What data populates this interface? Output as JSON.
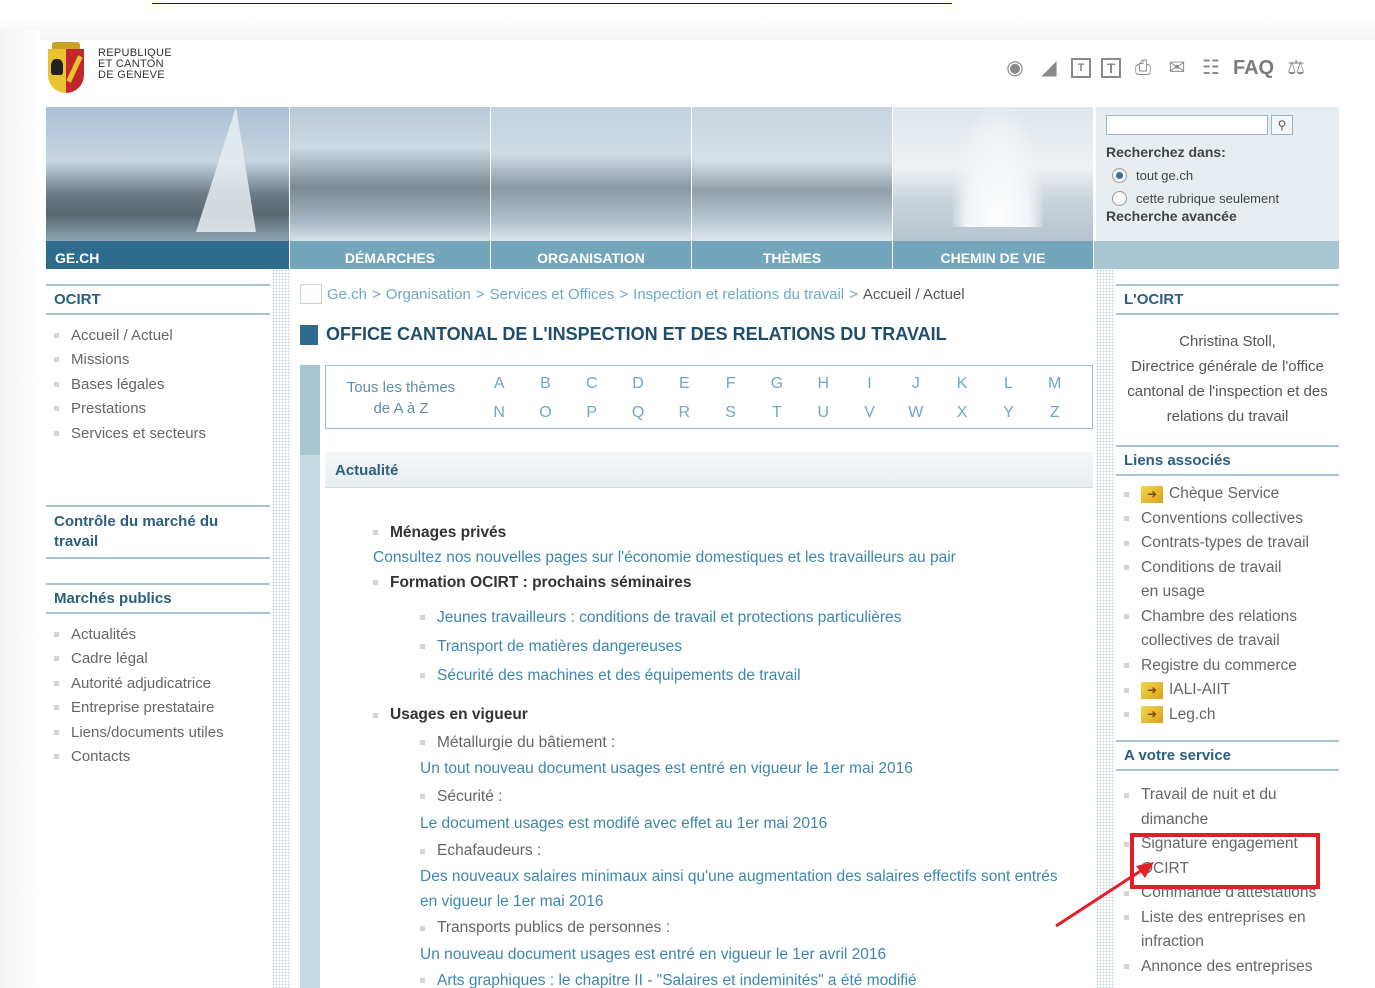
{
  "header": {
    "logo_lines": [
      "REPUBLIQUE",
      "ET CANTON",
      "DE GENEVE"
    ],
    "faq_label": "FAQ"
  },
  "search": {
    "label": "Recherchez dans:",
    "option_all": "tout ge.ch",
    "option_section": "cette rubrique seulement",
    "advanced": "Recherche avancée",
    "selected_option": "tout ge.ch"
  },
  "nav": {
    "home": "GE.CH",
    "items": [
      "DÉMARCHES",
      "ORGANISATION",
      "THÈMES",
      "CHEMIN DE VIE"
    ]
  },
  "left": {
    "ocirt_title": "OCIRT",
    "ocirt_items": [
      "Accueil / Actuel",
      "Missions",
      "Bases légales",
      "Prestations",
      "Services et secteurs"
    ],
    "controle_title": "Contrôle du marché du travail",
    "marches_title": "Marchés publics",
    "marches_items": [
      "Actualités",
      "Cadre légal",
      "Autorité adjudicatrice",
      "Entreprise prestataire",
      "Liens/documents utiles",
      "Contacts"
    ]
  },
  "breadcrumb": {
    "items": [
      "Ge.ch",
      "Organisation",
      "Services et Offices",
      "Inspection et relations du travail"
    ],
    "separator": ">",
    "current": "Accueil / Actuel"
  },
  "page_title": "OFFICE CANTONAL DE L'INSPECTION ET DES RELATIONS DU TRAVAIL",
  "alphabet": {
    "lead_line1": "Tous les thèmes",
    "lead_line2": "de A à Z",
    "letters": [
      "A",
      "B",
      "C",
      "D",
      "E",
      "F",
      "G",
      "H",
      "I",
      "J",
      "K",
      "L",
      "M",
      "N",
      "O",
      "P",
      "Q",
      "R",
      "S",
      "T",
      "U",
      "V",
      "W",
      "X",
      "Y",
      "Z"
    ]
  },
  "news": {
    "heading": "Actualité",
    "menages_title": "Ménages privés",
    "menages_link": "Consultez nos nouvelles pages sur l'économie domestiques et les travailleurs au pair",
    "formation_title": "Formation OCIRT : prochains séminaires",
    "formation_links": [
      "Jeunes travailleurs : conditions de travail et protections particulières",
      "Transport de matières dangereuses",
      "Sécurité des machines et des équipements de travail"
    ],
    "usages_title": "Usages en vigueur",
    "metallurgie_label": "Métallurgie du bâtiement :",
    "metallurgie_link": "Un tout nouveau document usages est entré en vigueur le 1er mai 2016",
    "securite_label": "Sécurité :",
    "securite_link": "Le document usages est modifé avec effet au 1er mai 2016",
    "echaf_label": "Echafaudeurs :",
    "echaf_link1": "Des nouveaux salaires minimaux ainsi qu'une augmentation des salaires effectifs sont entrés",
    "echaf_link2": "en vigueur le 1er mai 2016",
    "transports_label": "Transports publics de personnes :",
    "transports_link": "Un nouveau document usages est entré en vigueur le 1er avril 2016",
    "arts_link": "Arts graphiques : le chapitre II - \"Salaires et indeminités\" a été modifié"
  },
  "right": {
    "ocirt_title": "L'OCIRT",
    "director_lines": [
      "Christina Stoll,",
      "Directrice générale de l'office",
      "cantonal de l'inspection et des",
      "relations du travail"
    ],
    "liens_title": "Liens associés",
    "liens_items": [
      "Chèque Service",
      "Conventions collectives",
      "Contrats-types de travail",
      "Conditions de travail",
      "en usage",
      "Chambre des relations",
      "collectives de travail",
      "Registre du commerce",
      "IALI-AIIT",
      "Leg.ch"
    ],
    "service_title": "A votre service",
    "service_items": [
      "Travail de nuit et du",
      "dimanche",
      "Signature engagement",
      "OCIRT",
      "Commande d'attestations",
      "Liste des entreprises en",
      "infraction",
      "Annonce des entreprises"
    ]
  },
  "colors": {
    "accent": "#2f6b8c",
    "link": "#3d87ad",
    "highlight": "#e41e26"
  }
}
